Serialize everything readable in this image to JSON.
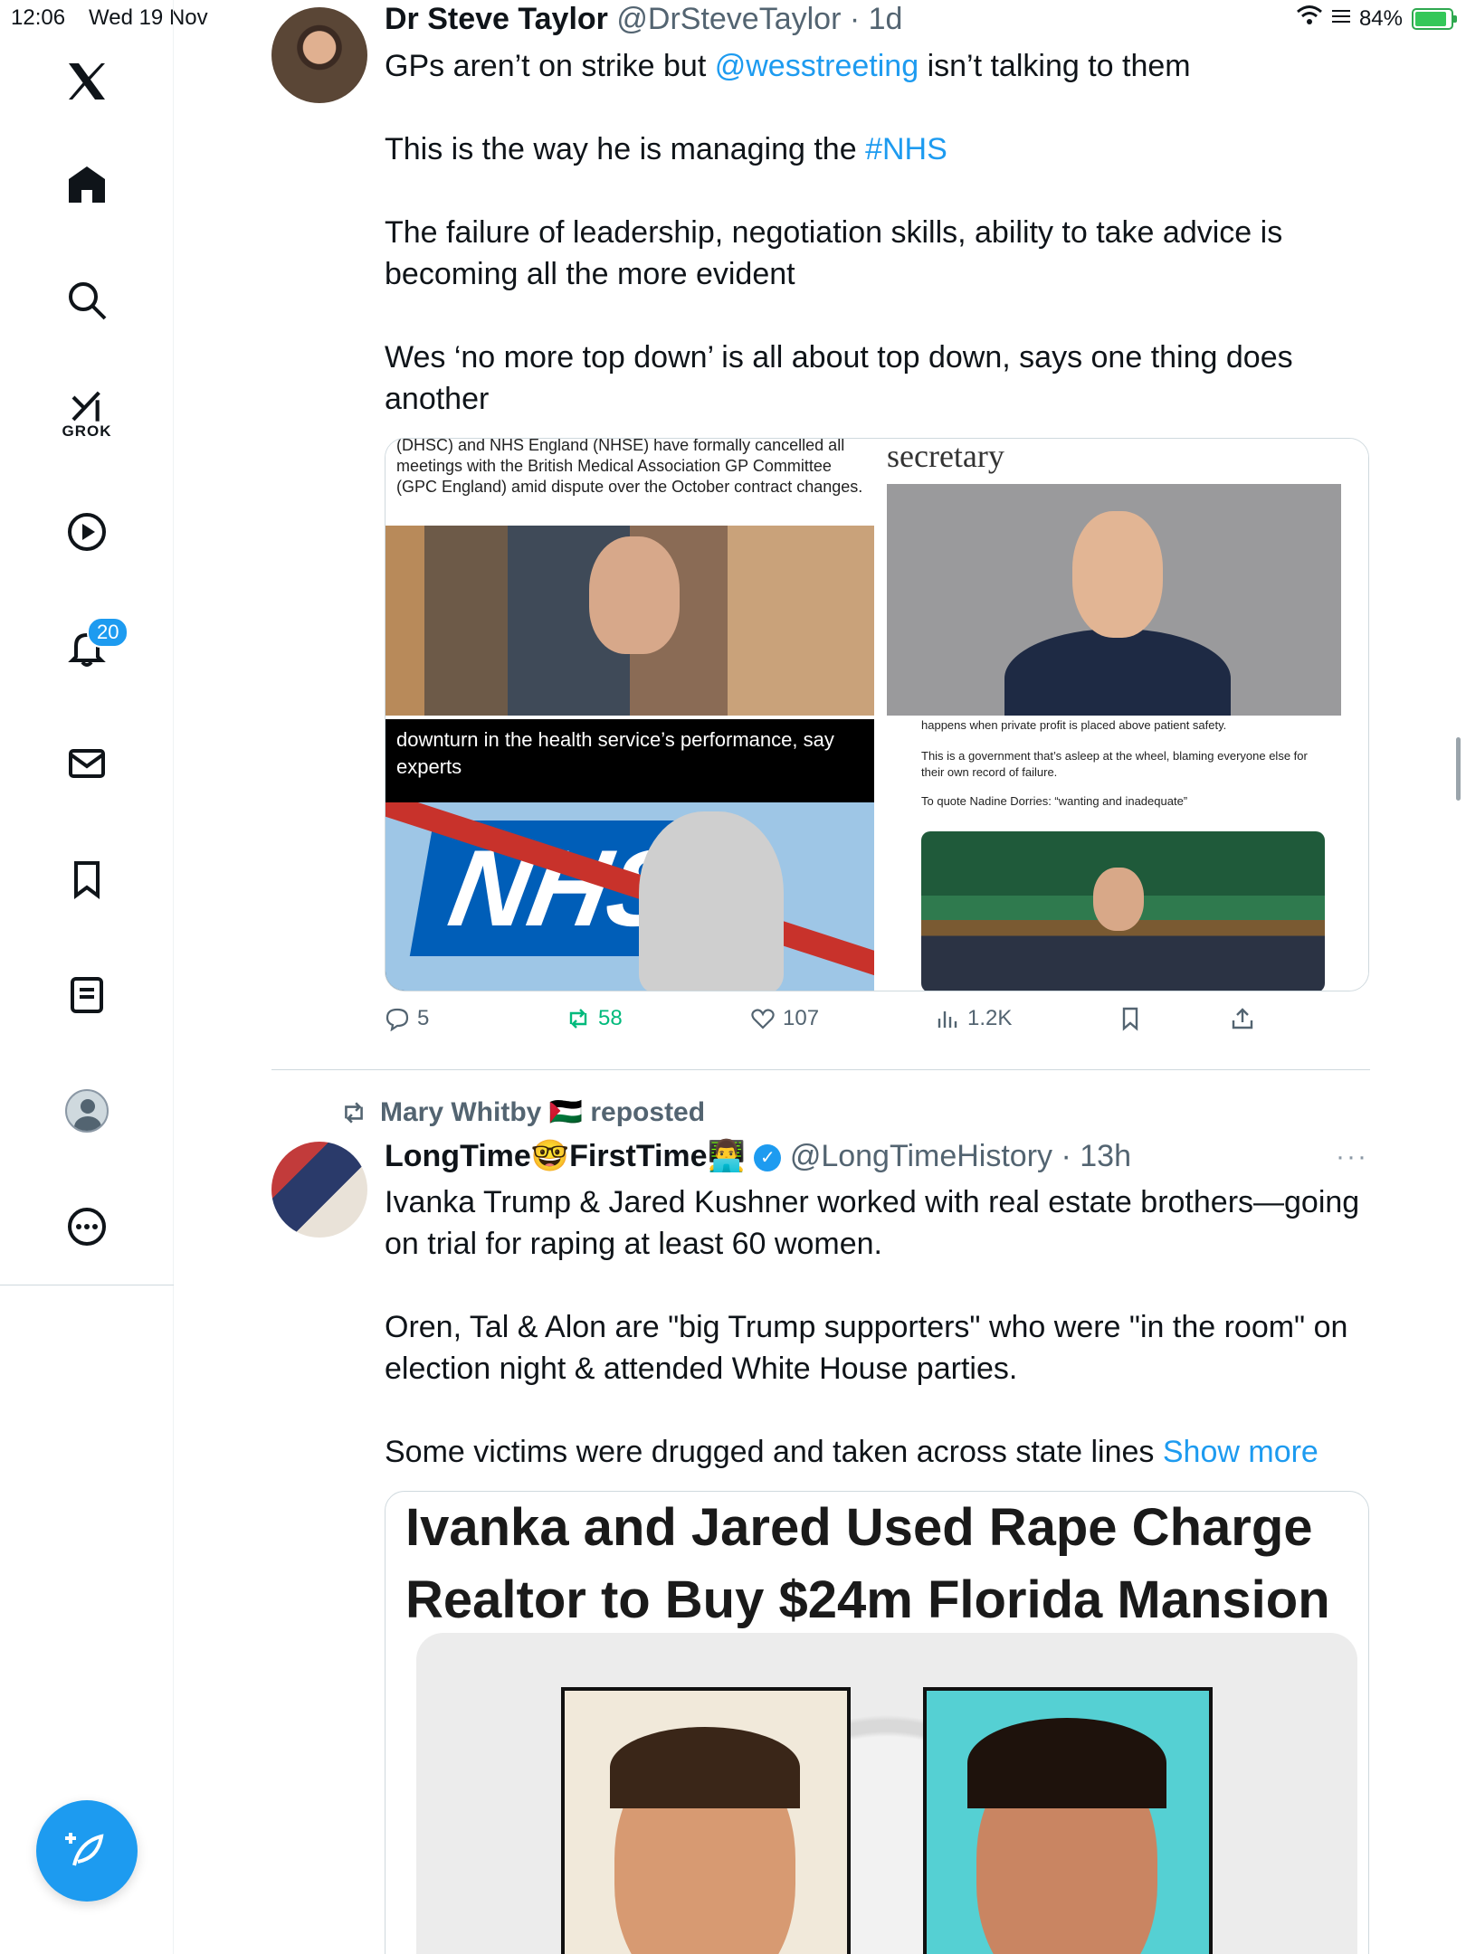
{
  "status_bar": {
    "time": "12:06",
    "date": "Wed 19 Nov",
    "battery": "84%"
  },
  "sidebar": {
    "items": [
      {
        "name": "logo",
        "icon": "x-logo-icon"
      },
      {
        "name": "home",
        "icon": "home-icon"
      },
      {
        "name": "explore",
        "icon": "search-icon"
      },
      {
        "name": "grok",
        "icon": "grok-icon",
        "label": "GROK"
      },
      {
        "name": "video",
        "icon": "play-icon"
      },
      {
        "name": "notifications",
        "icon": "bell-icon",
        "badge": "20"
      },
      {
        "name": "messages",
        "icon": "mail-icon"
      },
      {
        "name": "bookmarks",
        "icon": "bookmark-icon"
      },
      {
        "name": "lists",
        "icon": "list-icon"
      },
      {
        "name": "profile",
        "icon": "avatar-icon"
      },
      {
        "name": "more",
        "icon": "more-icon"
      }
    ],
    "compose_icon": "compose-icon"
  },
  "tweet1": {
    "name": "Dr Steve Taylor",
    "handle": "@DrSteveTaylor",
    "time": "· 1d",
    "p1_pre": "GPs aren’t on strike but ",
    "p1_link": "@wesstreeting",
    "p1_post": " isn’t talking to them",
    "p2_pre": "This is the way he is managing the ",
    "p2_link": "#NHS",
    "p3": "The failure of leadership, negotiation skills, ability to take advice is becoming all the more evident",
    "p4": "Wes ‘no more top down’ is all about top down, says one thing does another",
    "media": {
      "tl_caption": "(DHSC) and NHS England (NHSE) have formally cancelled all meetings with the British Medical Association GP Committee (GPC England) amid dispute over the October contract changes.",
      "tr_heading": "secretary",
      "bl_caption": "downturn in the health service’s performance, say experts",
      "bl_logo": "NHS",
      "br_line1": "happens when private profit is placed above patient safety.",
      "br_line2": "This is a government that’s asleep at the wheel, blaming everyone else for their own record of failure.",
      "br_line3": "To quote Nadine Dorries: “wanting and inadequate”"
    },
    "actions": {
      "replies": "5",
      "reposts": "58",
      "likes": "107",
      "views": "1.2K"
    }
  },
  "tweet2": {
    "reposted_by": "Mary Whitby 🇵🇸 reposted",
    "name": "LongTime🤓FirstTime👨‍💻",
    "handle": "@LongTimeHistory",
    "time": "· 13h",
    "more": "···",
    "p1": "Ivanka Trump & Jared Kushner worked with real estate brothers—going on trial for raping at least 60 women.",
    "p2": "Oren, Tal & Alon are \"big Trump supporters\" who were \"in the room\" on election night & attended White House parties.",
    "p3": "Some victims were drugged and taken across state lines",
    "show_more": "Show more",
    "card_line1": "Ivanka and Jared Used Rape Charge",
    "card_line2": "Realtor to Buy $24m Florida Mansion"
  },
  "colors": {
    "accent": "#1d9bf0",
    "repost_green": "#00ba7c",
    "secondary_text": "#536471"
  }
}
